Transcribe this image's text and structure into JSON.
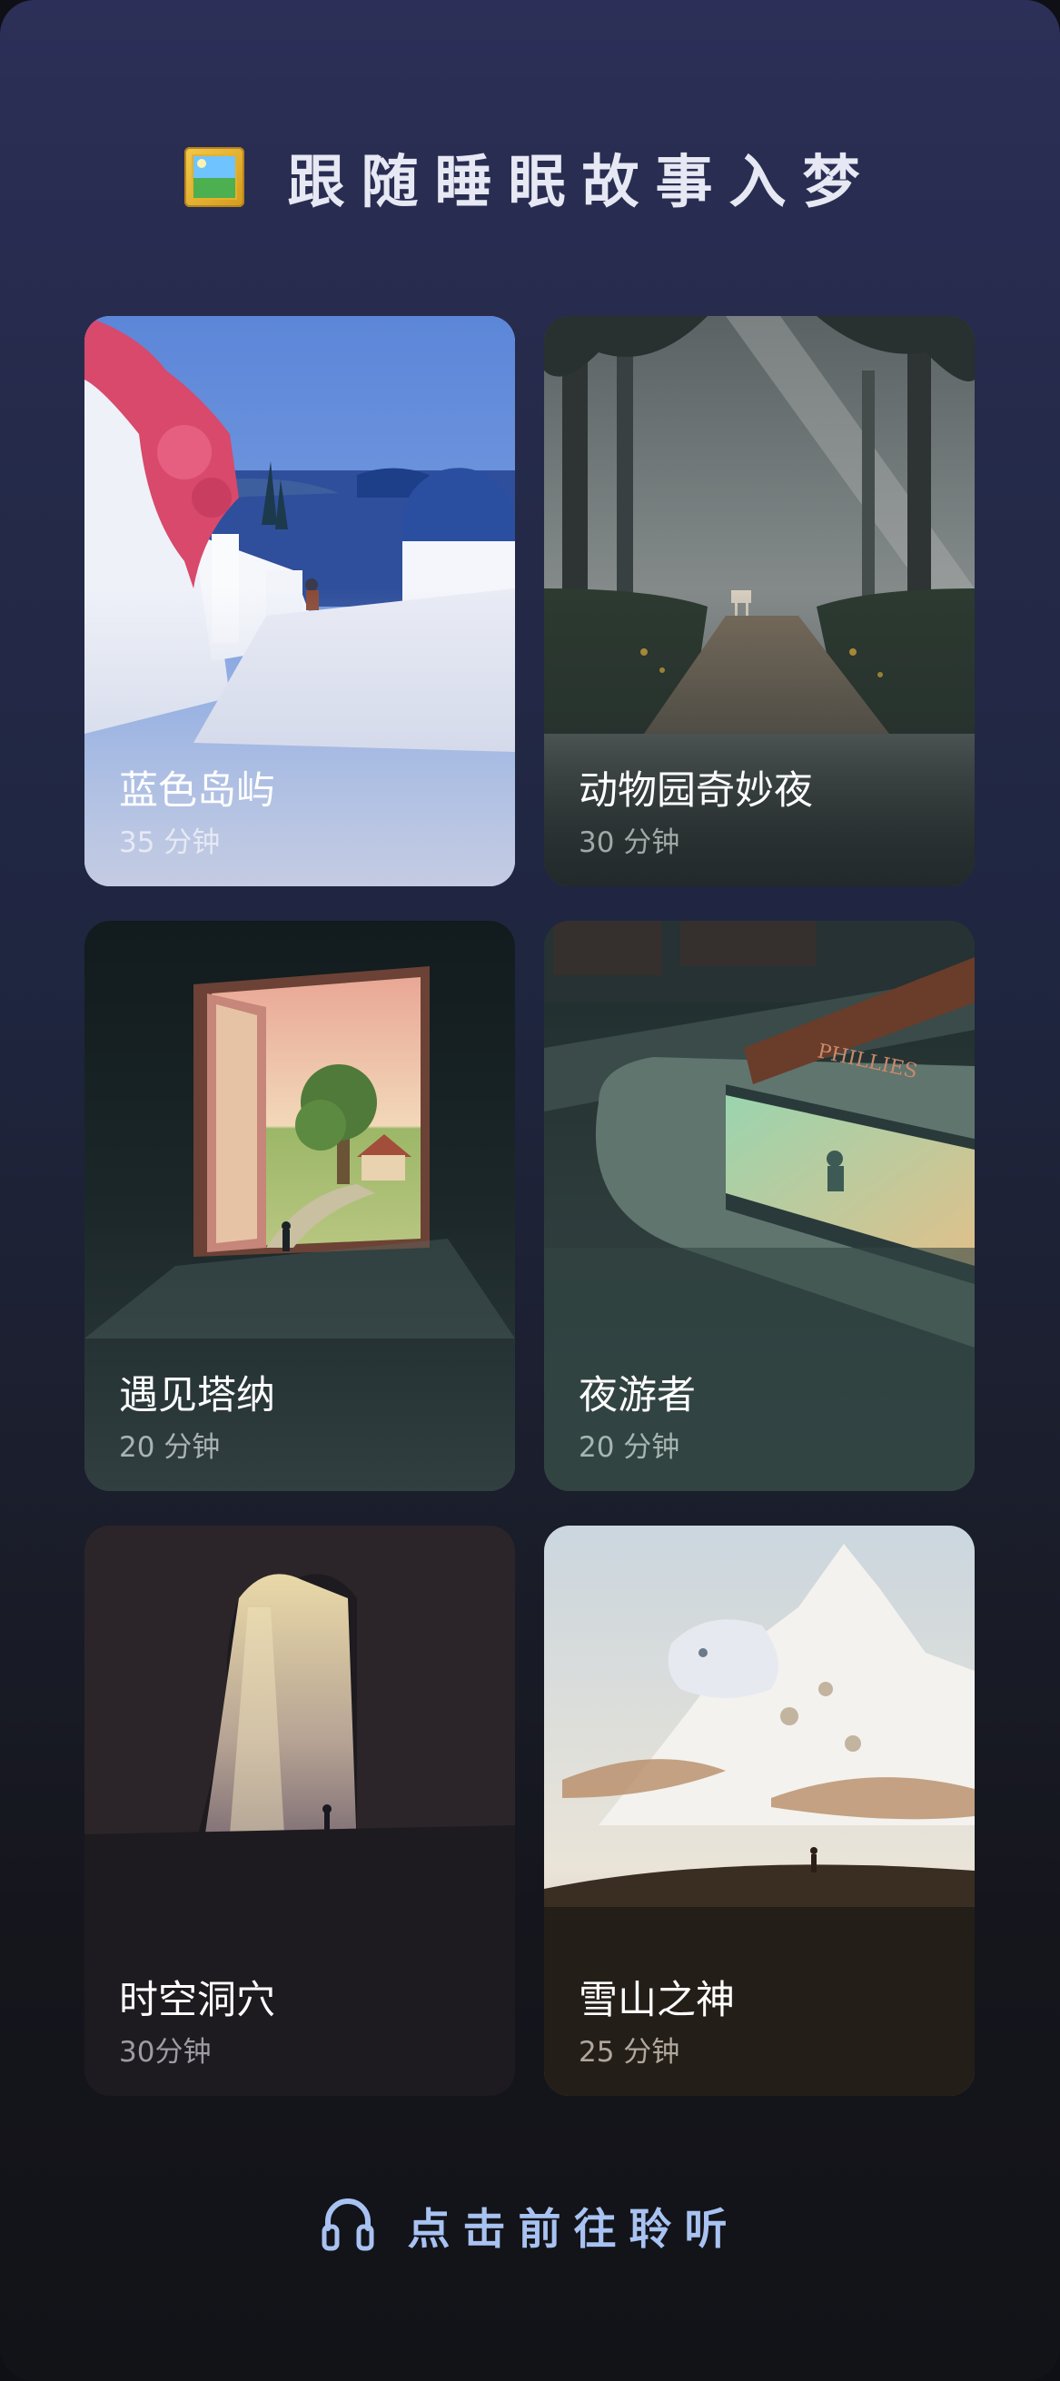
{
  "header": {
    "title": "跟随睡眠故事入梦",
    "icon": "framed-picture-icon"
  },
  "stories": [
    {
      "name": "蓝色岛屿",
      "duration": "35 分钟",
      "art": "santorini-island"
    },
    {
      "name": "动物园奇妙夜",
      "duration": "30 分钟",
      "art": "forest-path-deer"
    },
    {
      "name": "遇见塔纳",
      "duration": "20 分钟",
      "art": "open-door-meadow"
    },
    {
      "name": "夜游者",
      "duration": "20 分钟",
      "art": "night-diner"
    },
    {
      "name": "时空洞穴",
      "duration": "30分钟",
      "art": "cave-opening"
    },
    {
      "name": "雪山之神",
      "duration": "25 分钟",
      "art": "snow-leopard-mountain"
    }
  ],
  "footer": {
    "label": "点击前往聆听",
    "icon": "headphones-icon"
  },
  "colors": {
    "accent": "#a8c2f2",
    "title": "#e6e8f3"
  }
}
